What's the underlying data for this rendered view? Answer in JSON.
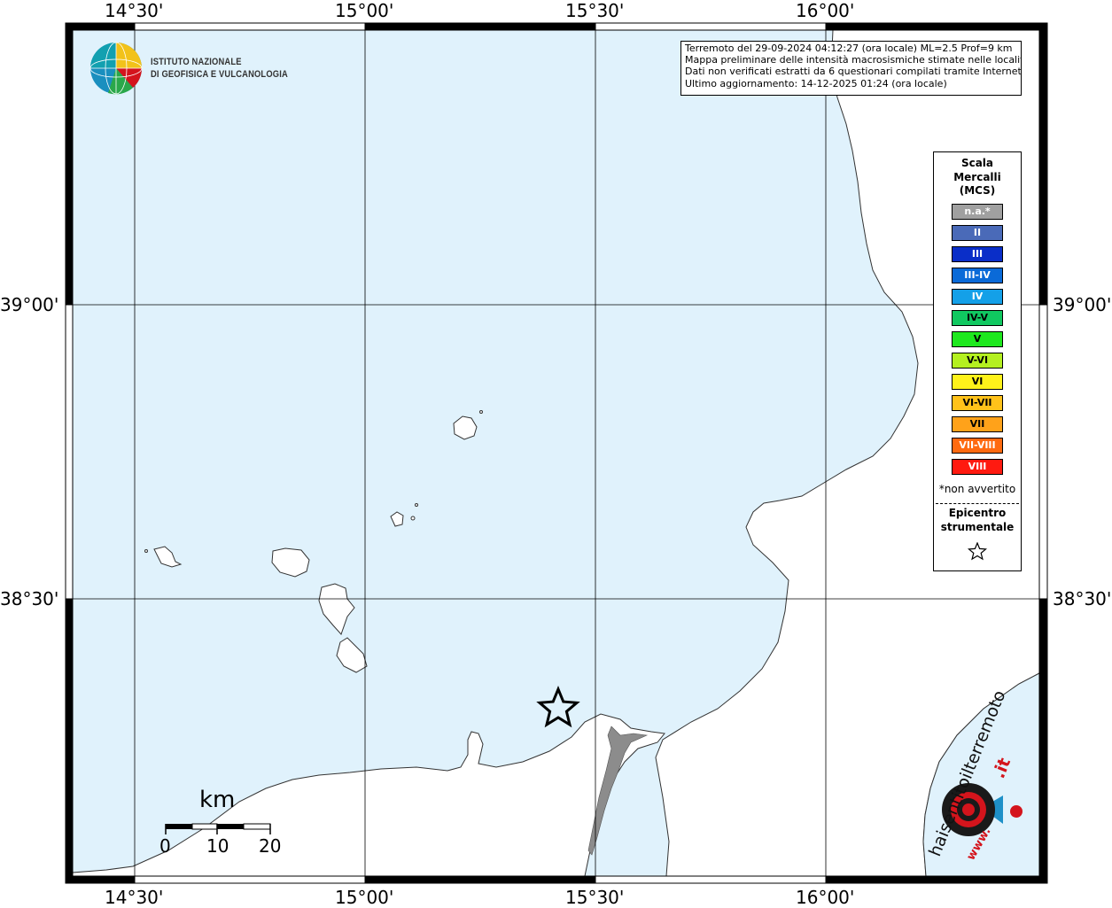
{
  "map": {
    "lon_labels": [
      "14°30'",
      "15°00'",
      "15°30'",
      "16°00'"
    ],
    "lat_labels": [
      "39°00'",
      "38°30'"
    ],
    "epicenter_marker": "star-icon"
  },
  "info": {
    "line1": "Terremoto del 29-09-2024 04:12:27 (ora locale) ML=2.5 Prof=9 km",
    "line2": "Mappa preliminare delle intensità macrosismiche stimate nelle località",
    "line3": "Dati non verificati estratti da 6 questionari compilati tramite Internet.",
    "line4": "Ultimo aggiornamento: 14-12-2025 01:24 (ora locale)"
  },
  "logo": {
    "line1": "ISTITUTO NAZIONALE",
    "line2": "DI GEOFISICA E VULCANOLOGIA"
  },
  "legend": {
    "title1": "Scala",
    "title2": "Mercalli",
    "title3": "(MCS)",
    "classes": [
      {
        "label": "n.a.*",
        "color": "#a0a0a0",
        "text_color": "#ffffff"
      },
      {
        "label": "II",
        "color": "#4a6ab8",
        "text_color": "#ffffff"
      },
      {
        "label": "III",
        "color": "#0a2ec8",
        "text_color": "#ffffff"
      },
      {
        "label": "III-IV",
        "color": "#0a6ad8",
        "text_color": "#ffffff"
      },
      {
        "label": "IV",
        "color": "#14a0e8",
        "text_color": "#ffffff"
      },
      {
        "label": "IV-V",
        "color": "#10c860",
        "text_color": "#000000"
      },
      {
        "label": "V",
        "color": "#1ee81e",
        "text_color": "#000000"
      },
      {
        "label": "V-VI",
        "color": "#b4f020",
        "text_color": "#000000"
      },
      {
        "label": "VI",
        "color": "#fff21a",
        "text_color": "#000000"
      },
      {
        "label": "VI-VII",
        "color": "#ffc21a",
        "text_color": "#000000"
      },
      {
        "label": "VII",
        "color": "#ffa21a",
        "text_color": "#000000"
      },
      {
        "label": "VII-VIII",
        "color": "#ff6a10",
        "text_color": "#ffffff"
      },
      {
        "label": "VIII",
        "color": "#ff1a10",
        "text_color": "#ffffff"
      }
    ],
    "note": "*non avvertito",
    "epicenter1": "Epicentro",
    "epicenter2": "strumentale"
  },
  "scalebar": {
    "unit": "km",
    "ticks": [
      "0",
      "10",
      "20"
    ]
  },
  "badge": {
    "text_main": "haisentitoilterremoto",
    "text_suffix": ".it",
    "text_www": "www."
  },
  "colors": {
    "sea": "#e0f2fc",
    "land": "#ffffff",
    "frame": "#000000",
    "grid": "#000000",
    "badge_red": "#d4141c"
  }
}
